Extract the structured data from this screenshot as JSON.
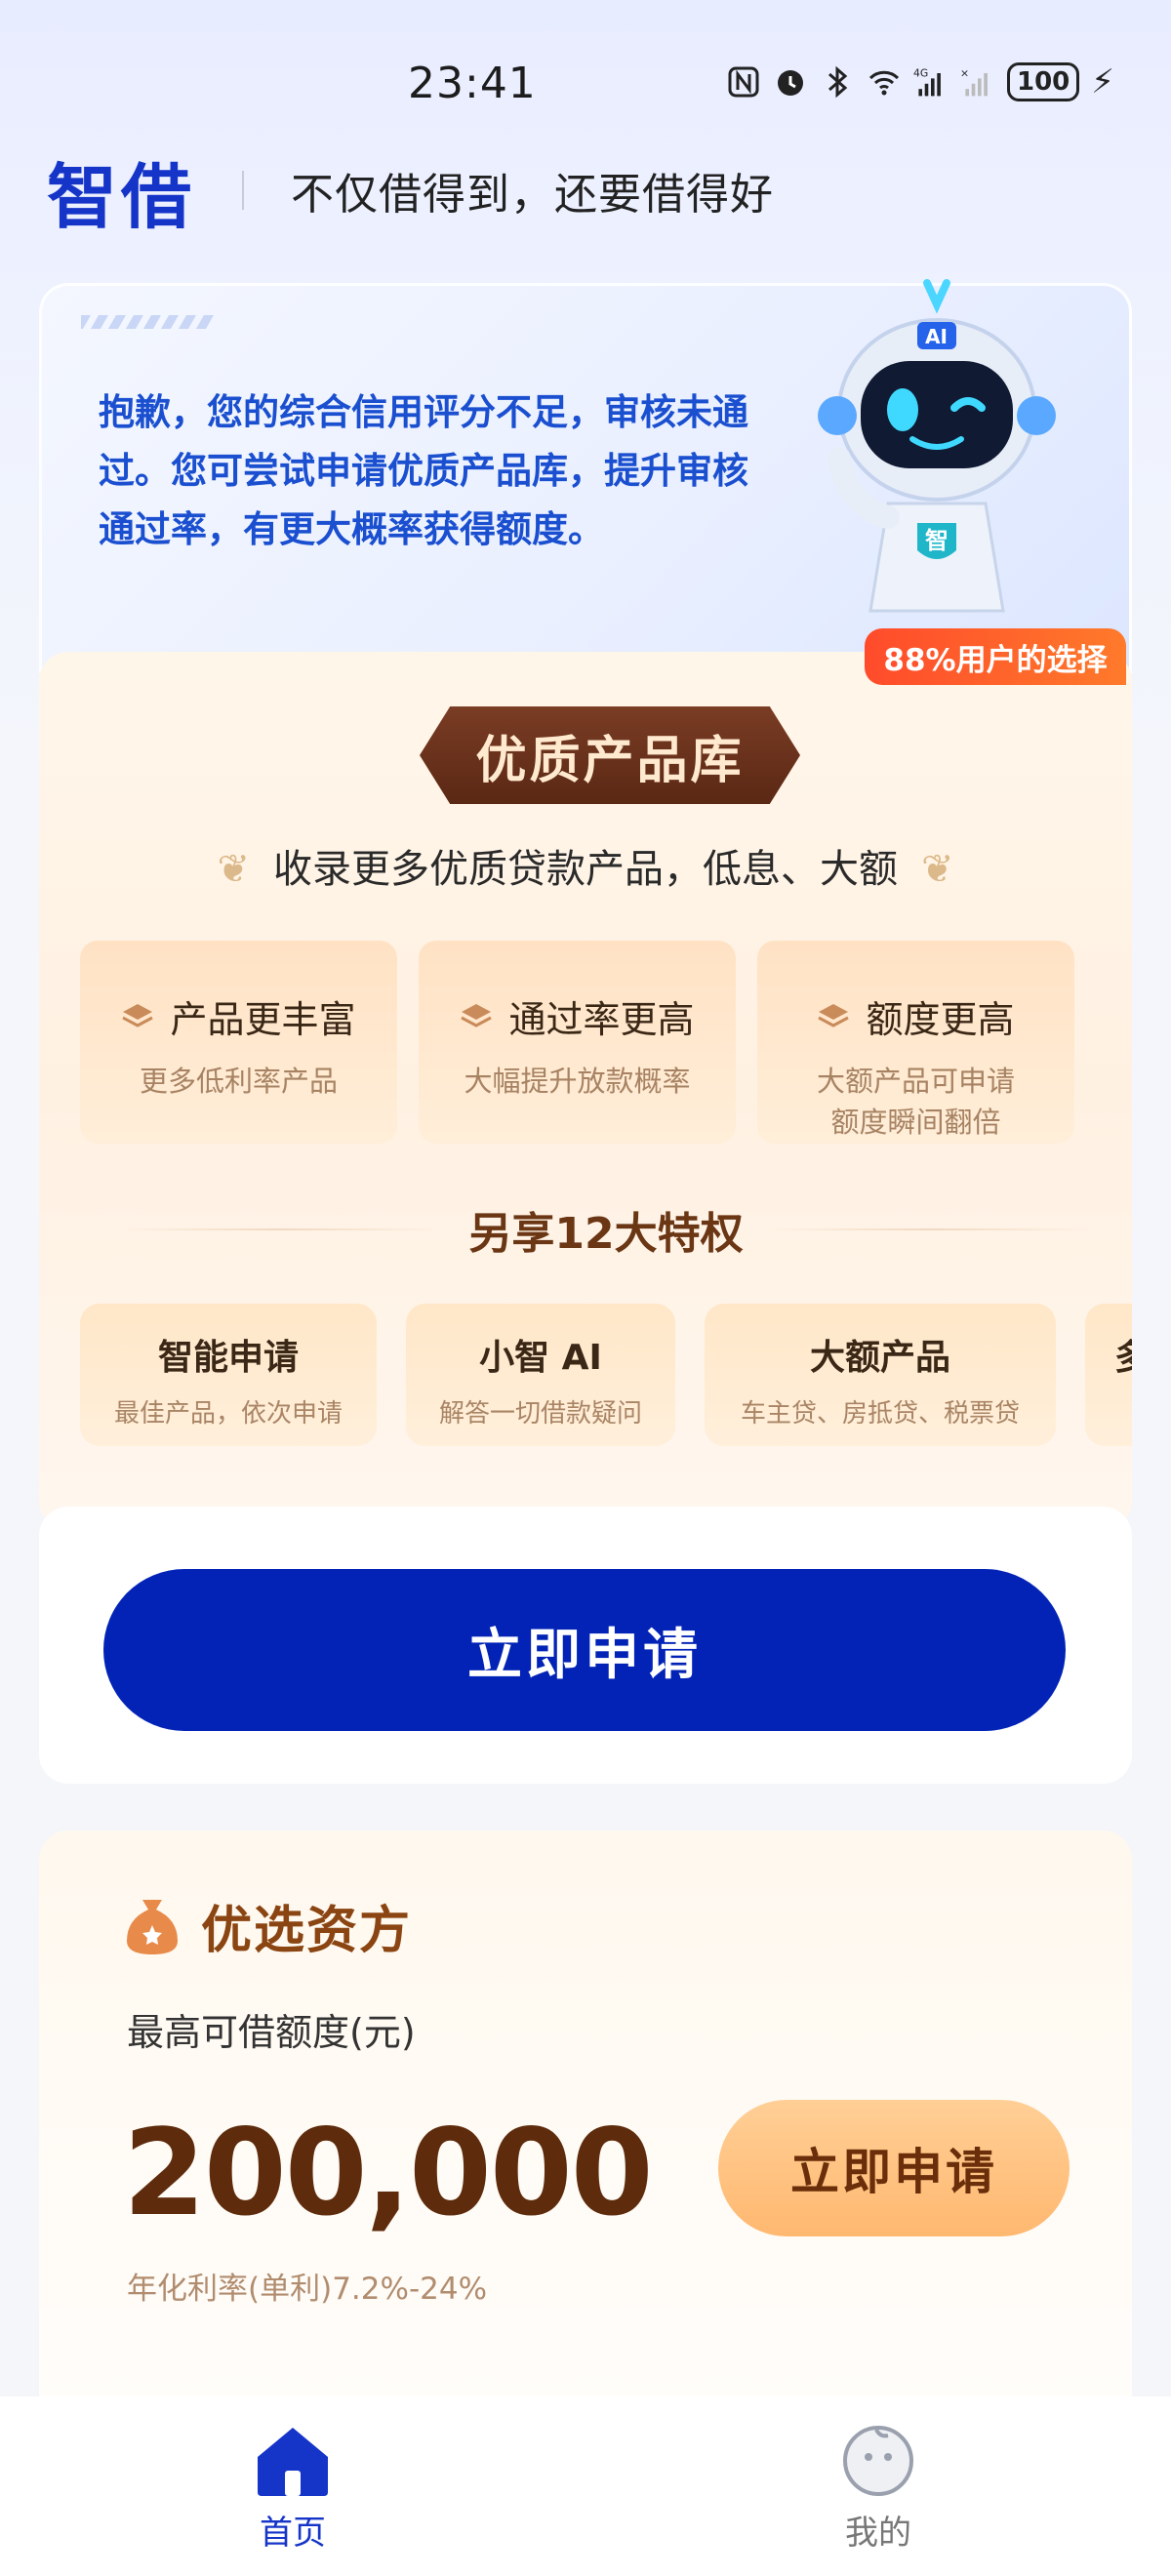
{
  "status_bar": {
    "time": "23:41",
    "battery": "100",
    "icons": [
      "nfc-icon",
      "alarm-icon",
      "bluetooth-icon",
      "wifi-icon",
      "signal-4g-icon",
      "signal-no-sim-icon",
      "battery-icon",
      "charging-icon"
    ]
  },
  "header": {
    "logo": "智借",
    "slogan": "不仅借得到，还要借得好"
  },
  "notice": {
    "text": "抱歉，您的综合信用评分不足，审核未通过。您可尝试申请优质产品库，提升审核通过率，有更大概率获得额度。",
    "badge": "88%用户的选择",
    "robot_icon_text": "AI",
    "robot_chest_text": "智"
  },
  "premium": {
    "title": "优质产品库",
    "subtitle": "收录更多优质贷款产品，低息、大额",
    "features": [
      {
        "title": "产品更丰富",
        "desc": "更多低利率产品"
      },
      {
        "title": "通过率更高",
        "desc": "大幅提升放款概率"
      },
      {
        "title": "额度更高",
        "desc": "大额产品可申请\n额度瞬间翻倍"
      }
    ],
    "privilege_title": "另享12大特权",
    "privileges": [
      {
        "title": "智能申请",
        "desc": "最佳产品，依次申请"
      },
      {
        "title": "小智 AI",
        "desc": "解答一切借款疑问"
      },
      {
        "title": "大额产品",
        "desc": "车主贷、房抵贷、税票贷"
      },
      {
        "title": "多",
        "desc": ""
      }
    ]
  },
  "apply": {
    "button_label": "立即申请"
  },
  "lender": {
    "title": "优选资方",
    "limit_label": "最高可借额度(元)",
    "limit_value": "200,000",
    "rate": "年化利率(单利)7.2%-24%",
    "button_label": "立即申请"
  },
  "bottom_nav": {
    "items": [
      {
        "label": "首页",
        "icon": "home-icon",
        "active": true
      },
      {
        "label": "我的",
        "icon": "profile-face-icon",
        "active": false
      }
    ]
  },
  "colors": {
    "brand_blue": "#0223b6",
    "notice_blue": "#1a4fd0",
    "brown": "#5e2c0c",
    "badge_red": "#ff4b2b"
  }
}
